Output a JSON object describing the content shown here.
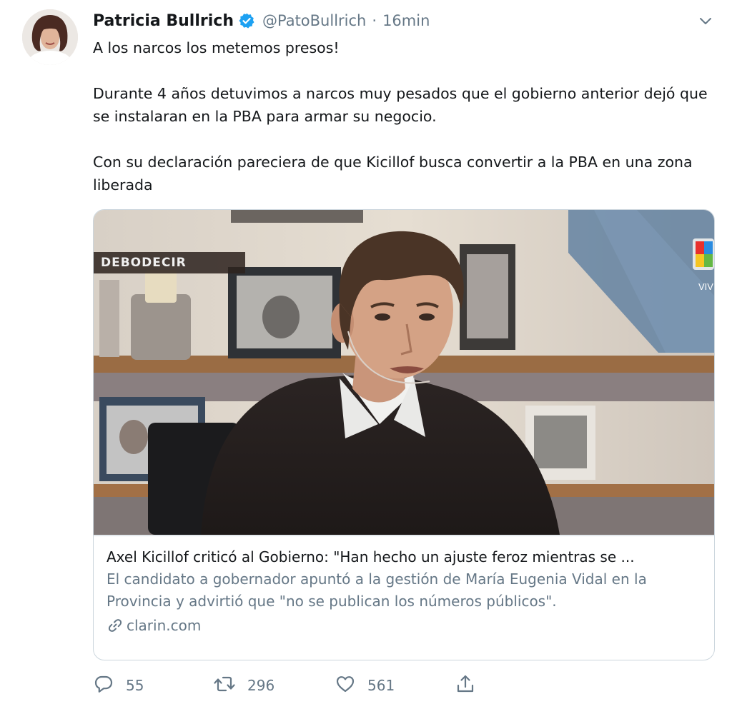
{
  "tweet": {
    "display_name": "Patricia Bullrich",
    "handle": "@PatoBullrich",
    "separator": "·",
    "timestamp": "16min",
    "verified": true,
    "text": {
      "line1": "A los narcos los metemos presos!",
      "para2": "Durante 4 años detuvimos a narcos muy pesados que el gobierno anterior dejó que se instalaran en la PBA para armar su negocio.",
      "para3": "Con su declaración pareciera de que Kicillof busca convertir a la PBA en una zona liberada"
    }
  },
  "card": {
    "image_label": "DEBODECIR",
    "title": "Axel Kicillof criticó al Gobierno: \"Han hecho un ajuste feroz mientras se ...",
    "description": "El candidato a gobernador apuntó a la gestión de María Eugenia Vidal en la Provincia y advirtió que \"no se publican los números públicos\".",
    "domain": "clarin.com",
    "channel_logo_text": "VIV"
  },
  "actions": {
    "replies": "55",
    "retweets": "296",
    "likes": "561"
  },
  "icons": {
    "verified": "verified-badge-icon",
    "caret": "chevron-down-icon",
    "reply": "reply-icon",
    "retweet": "retweet-icon",
    "like": "heart-icon",
    "share": "share-icon",
    "link": "link-icon"
  },
  "colors": {
    "accent": "#1da1f2",
    "secondary_text": "#657786",
    "primary_text": "#14171a",
    "border": "#ccd6dd"
  }
}
